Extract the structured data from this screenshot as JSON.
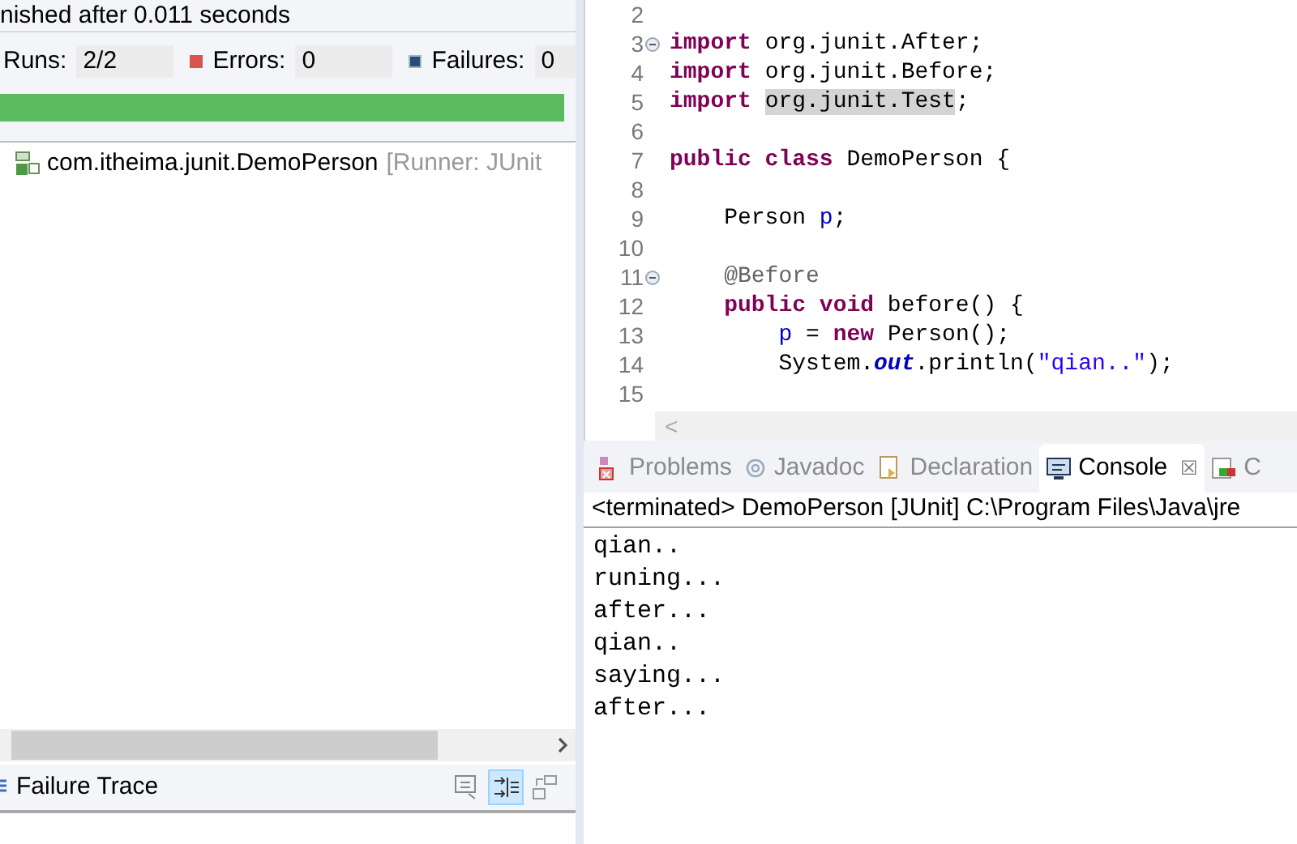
{
  "junit": {
    "status": "nished after 0.011 seconds",
    "counters": [
      {
        "kind": "runs",
        "label": "Runs:",
        "value": "2/2"
      },
      {
        "kind": "errors",
        "label": "Errors:",
        "value": "0"
      },
      {
        "kind": "failures",
        "label": "Failures:",
        "value": "0"
      }
    ],
    "progress": {
      "level": 1,
      "failed": false
    },
    "tree": [
      {
        "label": "com.itheima.junit.DemoPerson",
        "detail": "[Runner: JUnit"
      }
    ],
    "failure_trace": {
      "title": "Failure Trace",
      "toolbar": [
        {
          "selected": false
        },
        {
          "selected": true
        },
        {
          "selected": false
        }
      ]
    }
  },
  "editor": {
    "lines": [
      {
        "number": "2",
        "fold": false
      },
      {
        "number": "3",
        "fold": true,
        "tokens": [
          {
            "kind": "keyword",
            "text": "import "
          },
          {
            "kind": "plain",
            "text": "org.junit.After;"
          }
        ]
      },
      {
        "number": "4",
        "fold": false,
        "tokens": [
          {
            "kind": "keyword",
            "text": "import "
          },
          {
            "kind": "plain",
            "text": "org.junit.Before;"
          }
        ]
      },
      {
        "number": "5",
        "fold": false,
        "tokens": [
          {
            "kind": "keyword",
            "text": "import "
          },
          {
            "kind": "highlight",
            "text": "org.junit.Test"
          },
          {
            "kind": "plain",
            "text": ";"
          }
        ]
      },
      {
        "number": "6",
        "fold": false
      },
      {
        "number": "7",
        "fold": false,
        "tokens": [
          {
            "kind": "keyword",
            "text": "public class "
          },
          {
            "kind": "plain",
            "text": "DemoPerson {"
          }
        ]
      },
      {
        "number": "8",
        "fold": false
      },
      {
        "number": "9",
        "fold": false,
        "tokens": [
          {
            "kind": "plain",
            "text": "    Person "
          },
          {
            "kind": "field",
            "text": "p"
          },
          {
            "kind": "plain",
            "text": ";"
          }
        ]
      },
      {
        "number": "10",
        "fold": false
      },
      {
        "number": "11",
        "fold": true,
        "tokens": [
          {
            "kind": "annotation",
            "text": "    @Before"
          }
        ]
      },
      {
        "number": "12",
        "fold": false,
        "tokens": [
          {
            "kind": "keyword",
            "text": "    public void "
          },
          {
            "kind": "plain",
            "text": "before() {"
          }
        ]
      },
      {
        "number": "13",
        "fold": false,
        "tokens": [
          {
            "kind": "field",
            "text": "        p"
          },
          {
            "kind": "plain",
            "text": " = "
          },
          {
            "kind": "keyword",
            "text": "new "
          },
          {
            "kind": "plain",
            "text": "Person();"
          }
        ]
      },
      {
        "number": "14",
        "fold": false,
        "tokens": [
          {
            "kind": "plain",
            "text": "        System."
          },
          {
            "kind": "static",
            "text": "out"
          },
          {
            "kind": "plain",
            "text": ".println("
          },
          {
            "kind": "string",
            "text": "\"qian..\""
          },
          {
            "kind": "plain",
            "text": ");"
          }
        ]
      },
      {
        "number": "15",
        "fold": false
      }
    ],
    "scroll_left": "<"
  },
  "views": {
    "tabs": [
      {
        "kind": "problems",
        "label": "Problems",
        "selected": false
      },
      {
        "kind": "javadoc",
        "label": "Javadoc",
        "selected": false
      },
      {
        "kind": "declaration",
        "label": "Declaration",
        "selected": false
      },
      {
        "kind": "console",
        "label": "Console",
        "selected": true,
        "close": "☒"
      },
      {
        "kind": "coverage",
        "label": "C",
        "selected": false
      }
    ]
  },
  "console": {
    "header": "<terminated> DemoPerson [JUnit] C:\\Program Files\\Java\\jre",
    "output": [
      "qian..",
      "runing...",
      "after...",
      "qian..",
      "saying...",
      "after..."
    ]
  }
}
